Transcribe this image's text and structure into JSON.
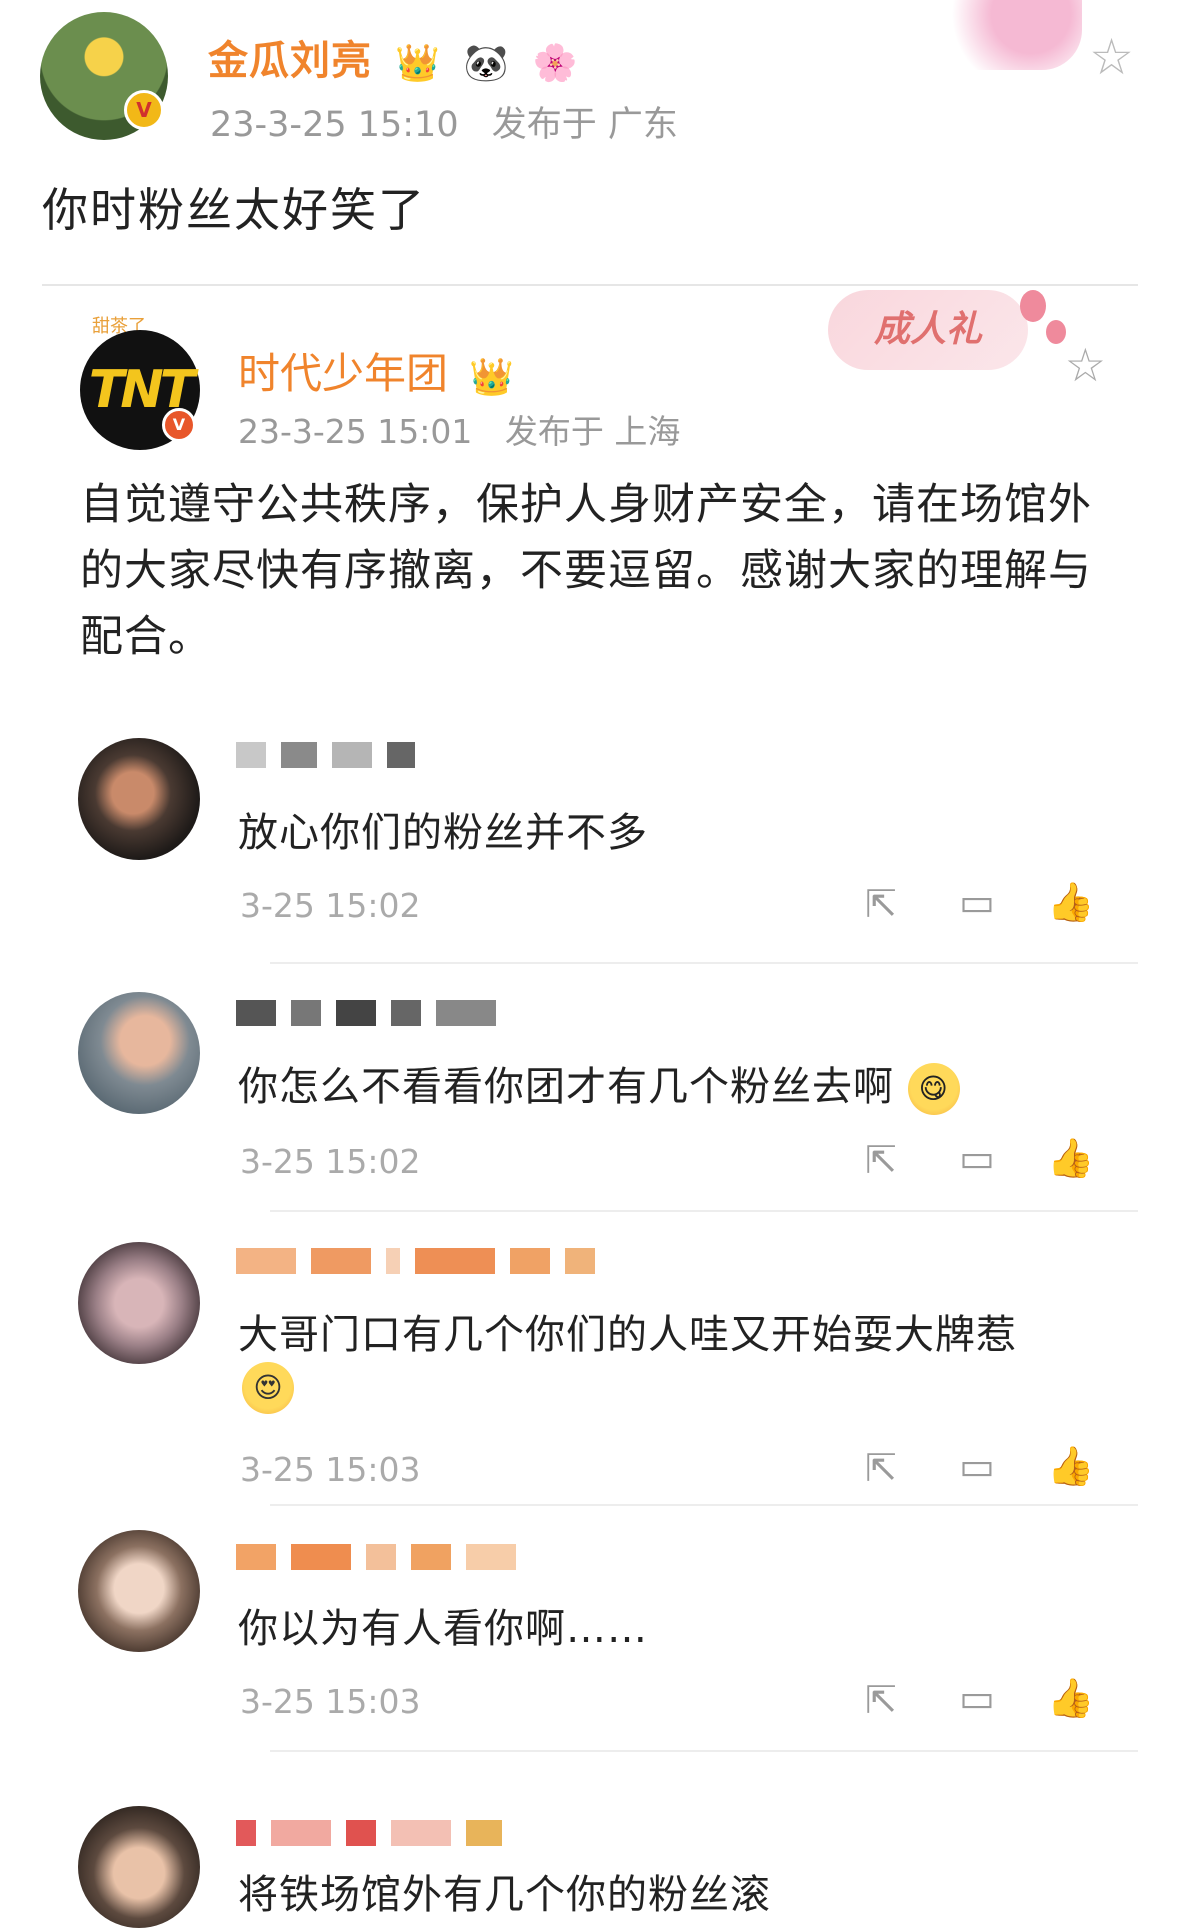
{
  "post": {
    "author": "金瓜刘亮",
    "author_emojis": [
      "👑",
      "🐼",
      "🌸"
    ],
    "verified_mark": "V",
    "time": "23-3-25 15:10",
    "location": "发布于 广东",
    "text": "你时粉丝太好笑了"
  },
  "repost": {
    "logo_text": "TNT",
    "logo_caption": "甜茶了",
    "author": "时代少年团",
    "author_emoji": "👑",
    "verified_mark": "V",
    "time": "23-3-25 15:01",
    "location": "发布于 上海",
    "badge": "成人礼",
    "text": "自觉遵守公共秩序，保护人身财产安全，请在场馆外的大家尽快有序撤离，不要逗留。感谢大家的理解与配合。"
  },
  "comments": [
    {
      "text": "放心你们的粉丝并不多",
      "time": "3-25 15:02",
      "emoji": ""
    },
    {
      "text": "你怎么不看看你团才有几个粉丝去啊",
      "time": "3-25 15:02",
      "emoji": "😋"
    },
    {
      "text": "大哥门口有几个你们的人哇又开始耍大牌惹",
      "time": "3-25 15:03",
      "emoji": "😍"
    },
    {
      "text": "你以为有人看你啊……",
      "time": "3-25 15:03",
      "emoji": ""
    },
    {
      "text": "将铁场馆外有几个你的粉丝滚",
      "time": "",
      "emoji": ""
    }
  ],
  "icons": {
    "star": "☆",
    "share": "⇱",
    "comment": "▭",
    "like": "👍"
  },
  "colors": {
    "name_orange": "#f0842c",
    "meta_gray": "#999999",
    "badge_gold": "#f2b817"
  }
}
